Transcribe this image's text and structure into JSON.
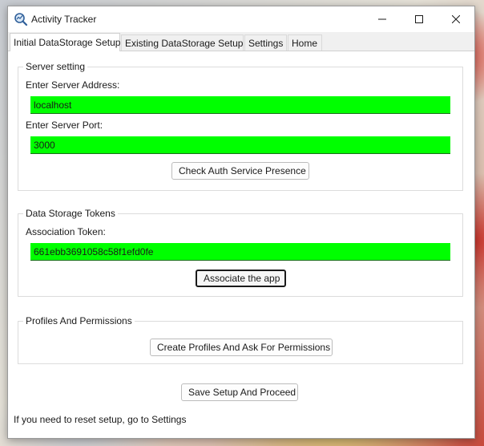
{
  "window": {
    "title": "Activity Tracker"
  },
  "tabs": [
    {
      "label": "Initial DataStorage Setup",
      "active": true
    },
    {
      "label": "Existing DataStorage Setup",
      "active": false
    },
    {
      "label": "Settings",
      "active": false
    },
    {
      "label": "Home",
      "active": false
    }
  ],
  "server_setting": {
    "title": "Server setting",
    "address_label": "Enter Server Address:",
    "address_value": "localhost",
    "port_label": "Enter Server Port:",
    "port_value": "3000",
    "check_button": "Check Auth Service Presence"
  },
  "data_storage_tokens": {
    "title": "Data Storage Tokens",
    "token_label": "Association Token:",
    "token_value": "661ebb3691058c58f1efd0fe",
    "associate_button": "Associate the app"
  },
  "profiles": {
    "title": "Profiles And Permissions",
    "create_button": "Create Profiles And Ask For Permissions"
  },
  "save_button": "Save Setup And Proceed",
  "footer_note": "If you need to reset setup, go to Settings",
  "colors": {
    "field_bg": "#00ff00",
    "window_bg": "#ffffff"
  }
}
